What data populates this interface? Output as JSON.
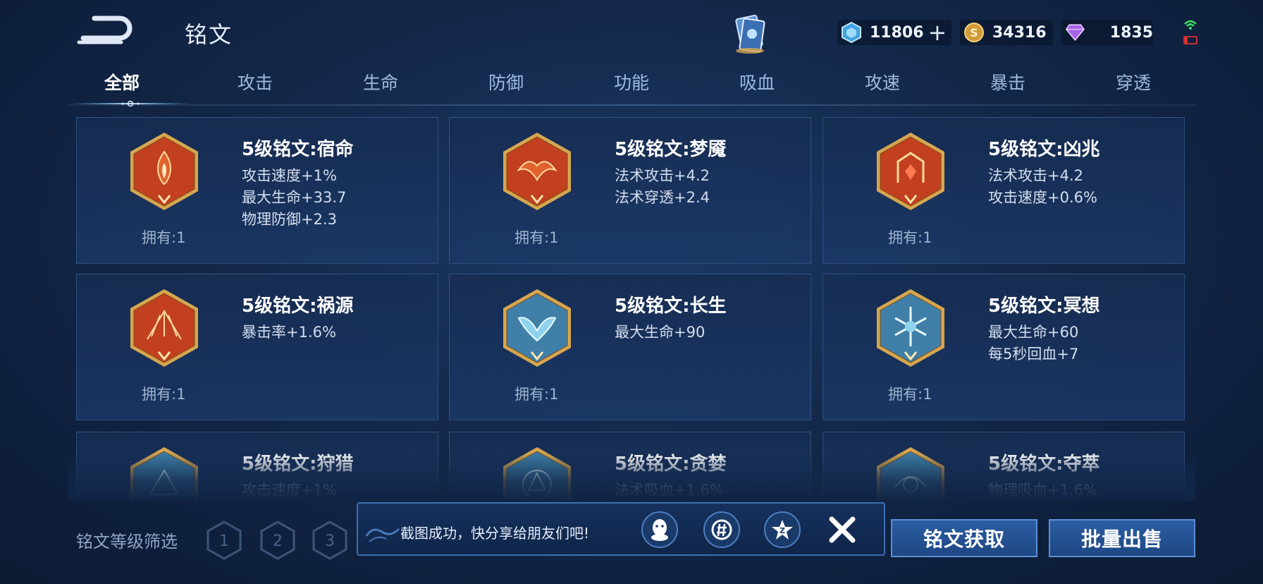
{
  "header": {
    "title": "铭文",
    "currencies": [
      {
        "name": "gem",
        "value": "11806"
      },
      {
        "name": "gold",
        "value": "34316"
      },
      {
        "name": "crystal",
        "value": "1835"
      }
    ]
  },
  "tabs": [
    "全部",
    "攻击",
    "生命",
    "防御",
    "功能",
    "吸血",
    "攻速",
    "暴击",
    "穿透"
  ],
  "active_tab": "全部",
  "cards": [
    {
      "name": "5级铭文:宿命",
      "stats": [
        "攻击速度+1%",
        "最大生命+33.7",
        "物理防御+2.3"
      ],
      "owned": "拥有:1",
      "color": "red"
    },
    {
      "name": "5级铭文:梦魇",
      "stats": [
        "法术攻击+4.2",
        "法术穿透+2.4"
      ],
      "owned": "拥有:1",
      "color": "red"
    },
    {
      "name": "5级铭文:凶兆",
      "stats": [
        "法术攻击+4.2",
        "攻击速度+0.6%"
      ],
      "owned": "拥有:1",
      "color": "red"
    },
    {
      "name": "5级铭文:祸源",
      "stats": [
        "暴击率+1.6%"
      ],
      "owned": "拥有:1",
      "color": "red"
    },
    {
      "name": "5级铭文:长生",
      "stats": [
        "最大生命+90"
      ],
      "owned": "拥有:1",
      "color": "blue"
    },
    {
      "name": "5级铭文:冥想",
      "stats": [
        "最大生命+60",
        "每5秒回血+7"
      ],
      "owned": "拥有:1",
      "color": "blue"
    },
    {
      "name": "5级铭文:狩猎",
      "stats": [
        "攻击速度+1%"
      ],
      "owned": "",
      "color": "blue"
    },
    {
      "name": "5级铭文:贪婪",
      "stats": [
        "法术吸血+1.6%"
      ],
      "owned": "",
      "color": "blue"
    },
    {
      "name": "5级铭文:夺萃",
      "stats": [
        "物理吸血+1.6%"
      ],
      "owned": "",
      "color": "blue"
    }
  ],
  "footer": {
    "filter_label": "铭文等级筛选",
    "levels": [
      "1",
      "2",
      "3"
    ],
    "toast_text": "截图成功，快分享给朋友们吧!",
    "share_icons": [
      "qq-icon",
      "wechat-moments-icon",
      "qzone-icon"
    ],
    "get_button": "铭文获取",
    "sell_button": "批量出售"
  },
  "colors": {
    "accent_blue": "#2b5ea3",
    "red_emblem": "#c2401f",
    "blue_emblem": "#3f7fa8",
    "gold_border": "#d6a650"
  }
}
